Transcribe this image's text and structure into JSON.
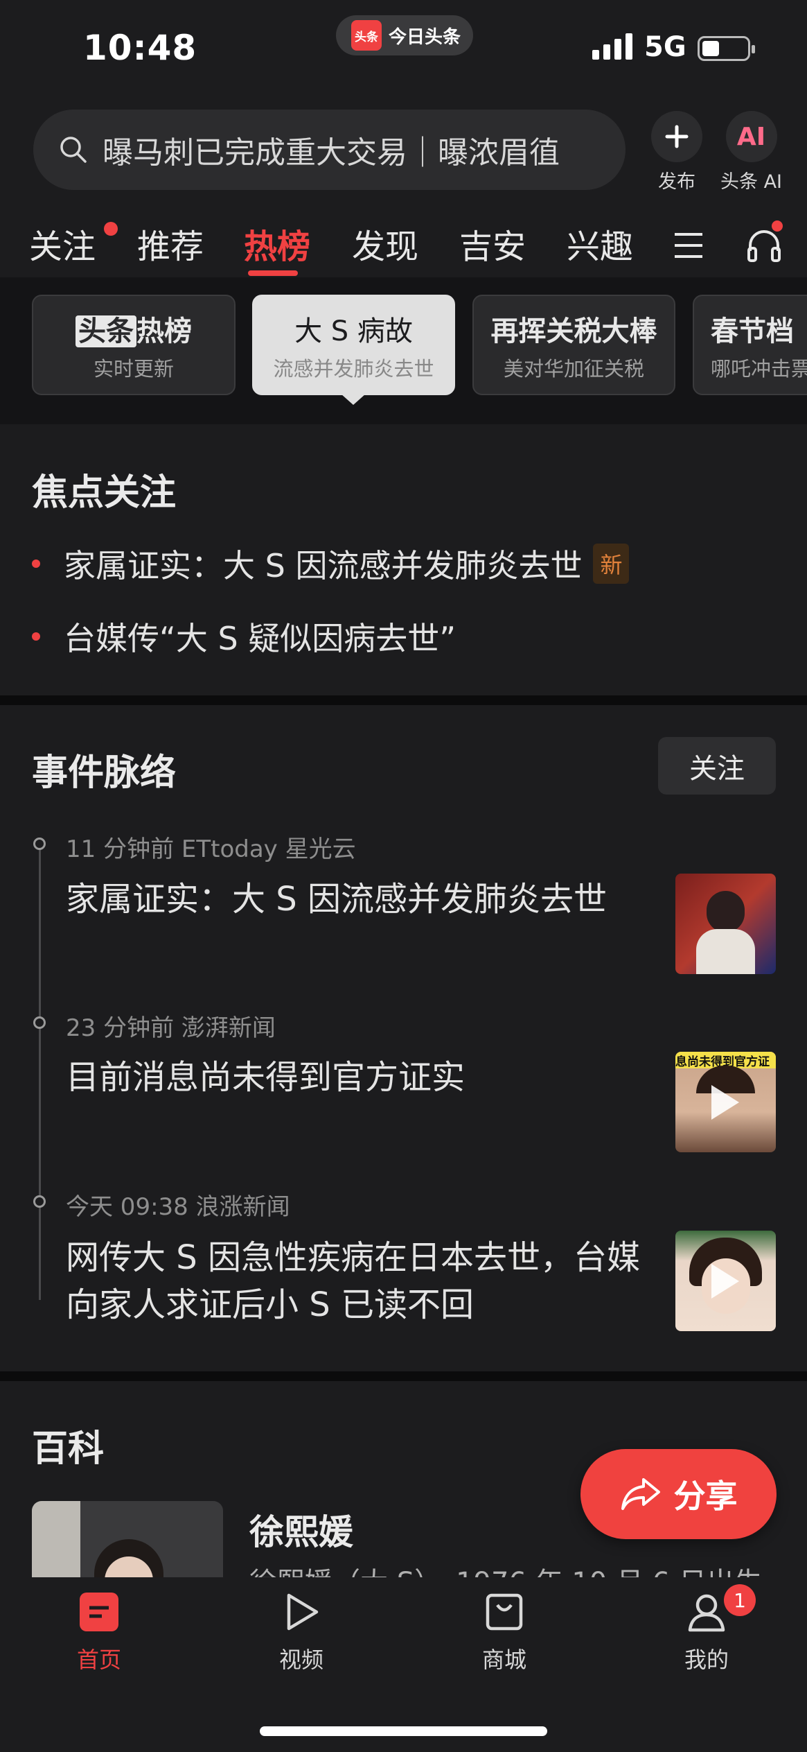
{
  "status_bar": {
    "time": "10:48",
    "network": "5G",
    "app_name": "今日头条",
    "app_logo_text": "头条"
  },
  "search": {
    "value": "曝马刺已完成重大交易｜曝浓眉徝"
  },
  "top_actions": {
    "publish_label": "发布",
    "ai_label": "头条 AI",
    "ai_icon_text": "AI"
  },
  "tabs": [
    {
      "label": "关注",
      "dot": true
    },
    {
      "label": "推荐"
    },
    {
      "label": "热榜",
      "active": true
    },
    {
      "label": "发现"
    },
    {
      "label": "吉安"
    },
    {
      "label": "兴趣"
    }
  ],
  "chips": [
    {
      "title_a": "头条",
      "title_b": "热榜",
      "subtitle": "实时更新"
    },
    {
      "title": "大 S 病故",
      "subtitle": "流感并发肺炎去世",
      "selected": true
    },
    {
      "title": "再挥关税大棒",
      "subtitle": "美对华加征关税"
    },
    {
      "title": "春节档",
      "subtitle": "哪吒冲击票"
    }
  ],
  "focus": {
    "title": "焦点关注",
    "items": [
      {
        "text": "家属证实：大 S 因流感并发肺炎去世",
        "badge": "新"
      },
      {
        "text": "台媒传“大 S 疑似因病去世”"
      }
    ]
  },
  "timeline": {
    "title": "事件脉络",
    "follow_label": "关注",
    "events": [
      {
        "meta": "11 分钟前  ETtoday 星光云",
        "title": "家属证实：大 S 因流感并发肺炎去世"
      },
      {
        "meta": "23 分钟前  澎湃新闻",
        "title": "目前消息尚未得到官方证实",
        "thumb_caption": "息尚未得到官方证"
      },
      {
        "meta": "今天 09:38  浪涨新闻",
        "title": "网传大 S 因急性疾病在日本去世，台媒向家人求证后小 S 已读不回"
      }
    ]
  },
  "baike": {
    "title": "百科",
    "name": "徐熙媛",
    "desc": "徐熙媛（大 S），1976 年 10 月 6 日出生"
  },
  "share_label": "分享",
  "bottom_nav": [
    {
      "label": "首页",
      "active": true
    },
    {
      "label": "视频"
    },
    {
      "label": "商城"
    },
    {
      "label": "我的",
      "badge": "1"
    }
  ],
  "colors": {
    "accent": "#f04142",
    "background": "#1c1c1e"
  }
}
